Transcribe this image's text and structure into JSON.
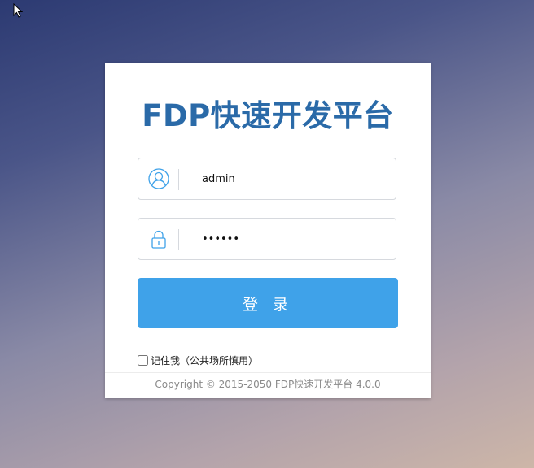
{
  "login": {
    "title": "FDP快速开发平台",
    "username": {
      "value": "admin",
      "icon": "user-icon"
    },
    "password": {
      "value": "123456",
      "icon": "lock-icon"
    },
    "submit_label": "登 录",
    "remember_label": "记住我（公共场所慎用）",
    "remember_checked": false,
    "footer": "Copyright © 2015-2050  FDP快速开发平台  4.0.0"
  },
  "colors": {
    "title": "#2a6aa8",
    "button": "#3fa2e9",
    "icon": "#3fa2e9"
  }
}
